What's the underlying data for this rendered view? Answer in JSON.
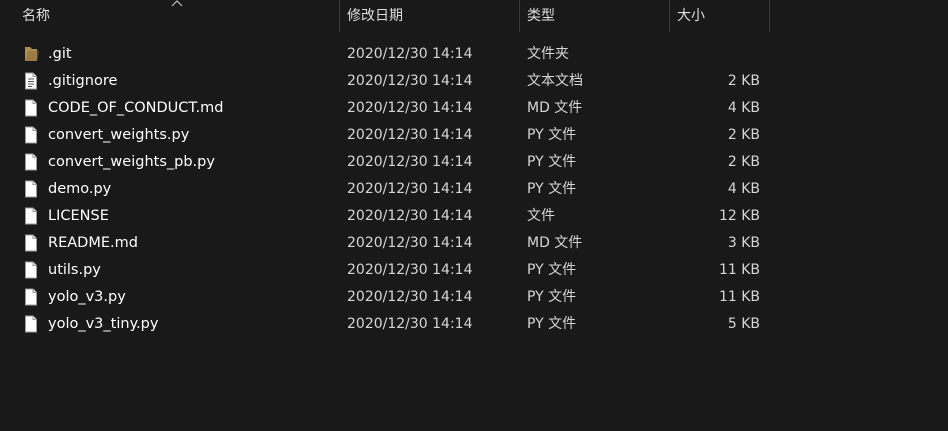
{
  "columns": {
    "name": "名称",
    "date": "修改日期",
    "type": "类型",
    "size": "大小"
  },
  "sort": {
    "column": "name",
    "direction": "ascending"
  },
  "files": [
    {
      "name": ".git",
      "date": "2020/12/30 14:14",
      "type": "文件夹",
      "size": "",
      "icon": "folder-icon"
    },
    {
      "name": ".gitignore",
      "date": "2020/12/30 14:14",
      "type": "文本文档",
      "size": "2 KB",
      "icon": "text-file-icon"
    },
    {
      "name": "CODE_OF_CONDUCT.md",
      "date": "2020/12/30 14:14",
      "type": "MD 文件",
      "size": "4 KB",
      "icon": "file-icon"
    },
    {
      "name": "convert_weights.py",
      "date": "2020/12/30 14:14",
      "type": "PY 文件",
      "size": "2 KB",
      "icon": "file-icon"
    },
    {
      "name": "convert_weights_pb.py",
      "date": "2020/12/30 14:14",
      "type": "PY 文件",
      "size": "2 KB",
      "icon": "file-icon"
    },
    {
      "name": "demo.py",
      "date": "2020/12/30 14:14",
      "type": "PY 文件",
      "size": "4 KB",
      "icon": "file-icon"
    },
    {
      "name": "LICENSE",
      "date": "2020/12/30 14:14",
      "type": "文件",
      "size": "12 KB",
      "icon": "file-icon"
    },
    {
      "name": "README.md",
      "date": "2020/12/30 14:14",
      "type": "MD 文件",
      "size": "3 KB",
      "icon": "file-icon"
    },
    {
      "name": "utils.py",
      "date": "2020/12/30 14:14",
      "type": "PY 文件",
      "size": "11 KB",
      "icon": "file-icon"
    },
    {
      "name": "yolo_v3.py",
      "date": "2020/12/30 14:14",
      "type": "PY 文件",
      "size": "11 KB",
      "icon": "file-icon"
    },
    {
      "name": "yolo_v3_tiny.py",
      "date": "2020/12/30 14:14",
      "type": "PY 文件",
      "size": "5 KB",
      "icon": "file-icon"
    }
  ],
  "colors": {
    "background": "#191919",
    "folder": "#b08d57",
    "file": "#ffffff",
    "text": "#ffffff",
    "secondary_text": "#d6d6d6"
  }
}
